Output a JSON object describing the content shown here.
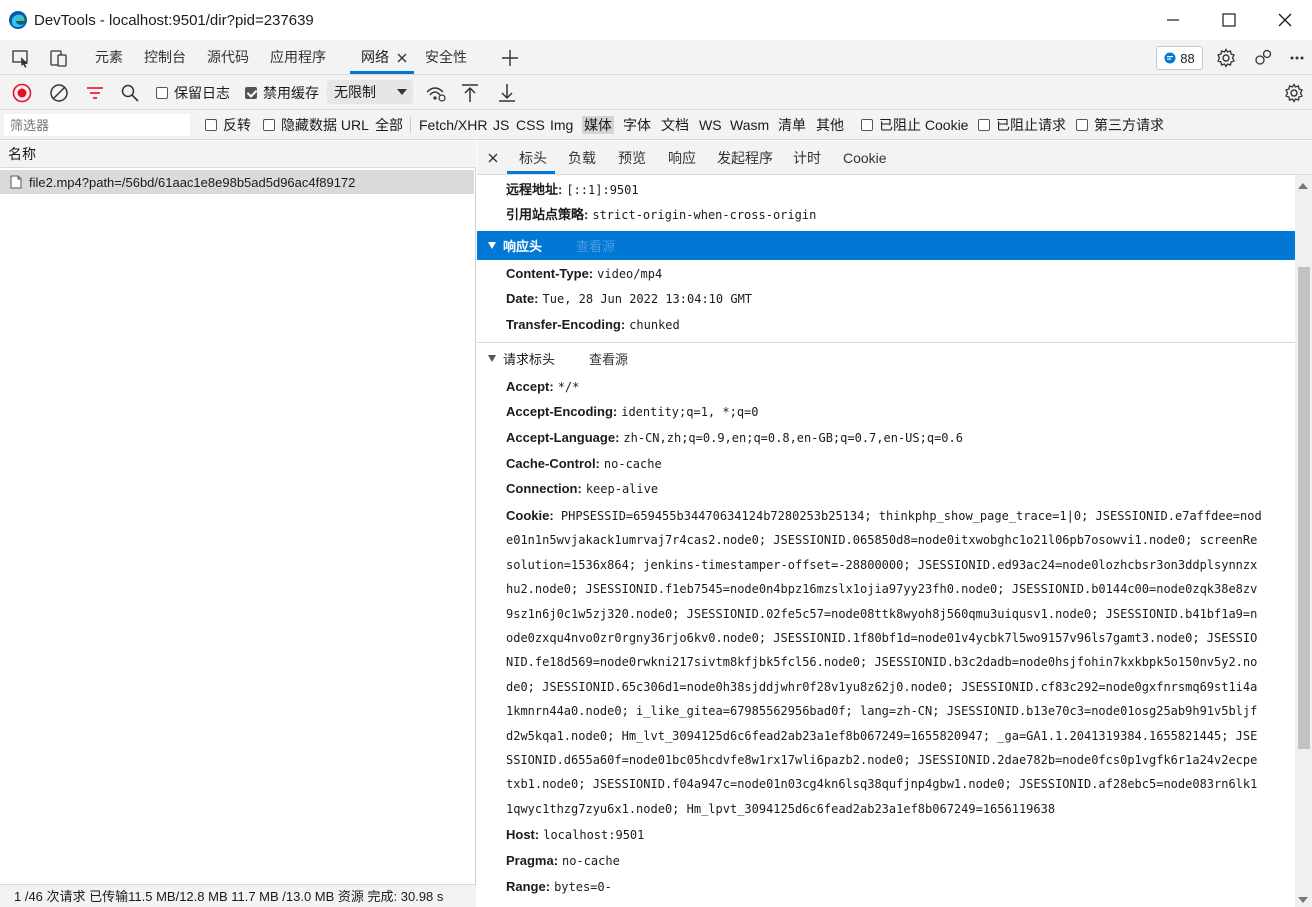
{
  "window": {
    "title": "DevTools - localhost:9501/dir?pid=237639"
  },
  "tabs": [
    {
      "label": "元素"
    },
    {
      "label": "控制台"
    },
    {
      "label": "源代码"
    },
    {
      "label": "应用程序"
    },
    {
      "label": "网络"
    },
    {
      "label": "安全性"
    }
  ],
  "issues_badge": "88",
  "toolbar": {
    "preserve_log": "保留日志",
    "disable_cache": "禁用缓存",
    "throttle": "无限制"
  },
  "filterbar": {
    "placeholder": "筛选器",
    "invert": "反转",
    "hide_data_urls": "隐藏数据 URL",
    "types": [
      "全部",
      "Fetch/XHR",
      "JS",
      "CSS",
      "Img",
      "媒体",
      "字体",
      "文档",
      "WS",
      "Wasm",
      "清单",
      "其他"
    ],
    "selected_type": "媒体",
    "blocked_cookies": "已阻止 Cookie",
    "blocked_requests": "已阻止请求",
    "third_party": "第三方请求"
  },
  "request_list": {
    "header": "名称",
    "rows": [
      {
        "name": "file2.mp4?path=/56bd/61aac1e8e98b5ad5d96ac4f89172"
      }
    ],
    "status": "1 /46 次请求  已传输11.5 MB/12.8 MB  11.7 MB /13.0 MB 资源  完成: 30.98 s"
  },
  "detail_tabs": [
    "标头",
    "负载",
    "预览",
    "响应",
    "发起程序",
    "计时",
    "Cookie"
  ],
  "general": [
    {
      "key": "远程地址:",
      "value": "[::1]:9501"
    },
    {
      "key": "引用站点策略:",
      "value": "strict-origin-when-cross-origin"
    }
  ],
  "response_headers": {
    "title": "响应头",
    "view_source": "查看源",
    "items": [
      {
        "key": "Content-Type:",
        "value": "video/mp4"
      },
      {
        "key": "Date:",
        "value": "Tue, 28 Jun 2022 13:04:10 GMT"
      },
      {
        "key": "Transfer-Encoding:",
        "value": "chunked"
      }
    ]
  },
  "request_headers": {
    "title": "请求标头",
    "view_source": "查看源",
    "items_before": [
      {
        "key": "Accept:",
        "value": "*/*"
      },
      {
        "key": "Accept-Encoding:",
        "value": "identity;q=1, *;q=0"
      },
      {
        "key": "Accept-Language:",
        "value": "zh-CN,zh;q=0.9,en;q=0.8,en-GB;q=0.7,en-US;q=0.6"
      },
      {
        "key": "Cache-Control:",
        "value": "no-cache"
      },
      {
        "key": "Connection:",
        "value": "keep-alive"
      }
    ],
    "cookie_key": "Cookie:",
    "cookie_lines": [
      "PHPSESSID=659455b34470634124b7280253b25134; thinkphp_show_page_trace=1|0; JSESSIONID.e7affdee=nod",
      "e01n1n5wvjakack1umrvaj7r4cas2.node0; JSESSIONID.065850d8=node0itxwobghc1o21l06pb7osowvi1.node0; screenRe",
      "solution=1536x864; jenkins-timestamper-offset=-28800000; JSESSIONID.ed93ac24=node0lozhcbsr3on3ddplsynnzx",
      "hu2.node0; JSESSIONID.f1eb7545=node0n4bpz16mzslx1ojia97yy23fh0.node0; JSESSIONID.b0144c00=node0zqk38e8zv",
      "9sz1n6j0c1w5zj320.node0; JSESSIONID.02fe5c57=node08ttk8wyoh8j560qmu3uiqusv1.node0; JSESSIONID.b41bf1a9=n",
      "ode0zxqu4nvo0zr0rgny36rjo6kv0.node0; JSESSIONID.1f80bf1d=node01v4ycbk7l5wo9157v96ls7gamt3.node0; JSESSIO",
      "NID.fe18d569=node0rwkni217sivtm8kfjbk5fcl56.node0; JSESSIONID.b3c2dadb=node0hsjfohin7kxkbpk5o150nv5y2.no",
      "de0; JSESSIONID.65c306d1=node0h38sjddjwhr0f28v1yu8z62j0.node0; JSESSIONID.cf83c292=node0gxfnrsmq69st1i4a",
      "1kmnrn44a0.node0; i_like_gitea=67985562956bad0f; lang=zh-CN; JSESSIONID.b13e70c3=node01osg25ab9h91v5bljf",
      "d2w5kqa1.node0; Hm_lvt_3094125d6c6fead2ab23a1ef8b067249=1655820947; _ga=GA1.1.2041319384.1655821445; JSE",
      "SSIONID.d655a60f=node01bc05hcdvfe8w1rx17wli6pazb2.node0; JSESSIONID.2dae782b=node0fcs0p1vgfk6r1a24v2ecpe",
      "txb1.node0; JSESSIONID.f04a947c=node01n03cg4kn6lsq38qufjnp4gbw1.node0; JSESSIONID.af28ebc5=node083rn6lk1",
      "1qwyc1thzg7zyu6x1.node0; Hm_lpvt_3094125d6c6fead2ab23a1ef8b067249=1656119638"
    ],
    "items_after": [
      {
        "key": "Host:",
        "value": "localhost:9501"
      },
      {
        "key": "Pragma:",
        "value": "no-cache"
      },
      {
        "key": "Range:",
        "value": "bytes=0-"
      }
    ]
  },
  "colors": {
    "accent": "#0078d4",
    "record": "#e81123",
    "filter_icon": "#e81123"
  }
}
